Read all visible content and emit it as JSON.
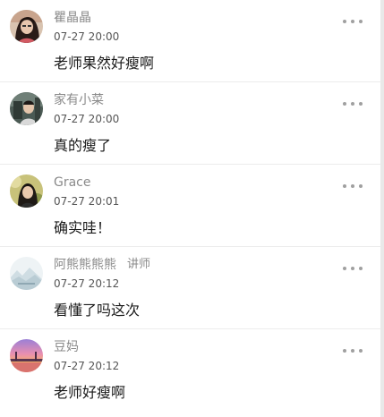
{
  "comments": [
    {
      "name": "瞿晶晶",
      "role": "",
      "time": "07-27 20:00",
      "text": "老师果然好瘦啊",
      "avatar": "avatar-woman-portrait"
    },
    {
      "name": "家有小菜",
      "role": "",
      "time": "07-27 20:00",
      "text": "真的瘦了",
      "avatar": "avatar-child-photo"
    },
    {
      "name": "Grace",
      "role": "",
      "time": "07-27 20:01",
      "text": "确实哇！",
      "avatar": "avatar-girl-outdoor"
    },
    {
      "name": "阿熊熊熊熊",
      "role": "讲师",
      "time": "07-27 20:12",
      "text": "看懂了吗这次",
      "avatar": "avatar-pale-landscape"
    },
    {
      "name": "豆妈",
      "role": "",
      "time": "07-27 20:12",
      "text": "老师好瘦啊",
      "avatar": "avatar-sunset-bridge"
    }
  ],
  "more_icon": "more-horizontal-icon"
}
